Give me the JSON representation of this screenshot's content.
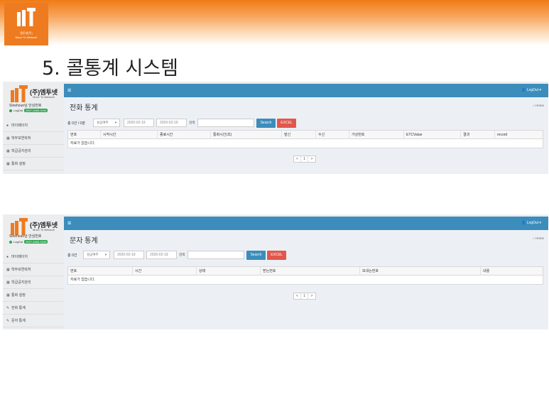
{
  "slide": {
    "title": "5. 콜통계 시스템",
    "logo_text": "엠투넷(주)",
    "logo_sub": "Move To Network"
  },
  "brand": {
    "name": "(주)엠투넷",
    "sub": "Move To Network"
  },
  "colors": {
    "accent_orange": "#ee7b20",
    "topbar_blue": "#3c8dbc",
    "search_blue": "#3c8dbc",
    "excel_red": "#e2574c",
    "online_green": "#2ea44f"
  },
  "screen1": {
    "user": "Sinehoun님 안심번호",
    "status": "LogOut",
    "phone": "0507-8465-0106",
    "logout_label": "LogOut",
    "menu": [
      {
        "label": "마이페이지",
        "icon": "dashboard-icon",
        "glyph": "●"
      },
      {
        "label": "학부모연락처",
        "icon": "grid-icon",
        "glyph": "▦"
      },
      {
        "label": "학급공지관리",
        "icon": "grid-icon",
        "glyph": "▦"
      },
      {
        "label": "통화 설정",
        "icon": "grid-icon",
        "glyph": "▦"
      }
    ],
    "page_title": "전화 통계",
    "home_label": "Home",
    "count": "총 0건 / 0분",
    "select_value": "성공여부",
    "date_from": "2020-02-19",
    "date_to": "2020-02-19",
    "search_label": "검색",
    "search_button": "Search",
    "excel_button": "EXCEL",
    "columns": [
      "번호",
      "시작시간",
      "종료시간",
      "통화시간(초)",
      "발신",
      "수신",
      "가상번호",
      "ETCValue",
      "결과",
      "record"
    ],
    "empty": "자료가 없습니다.",
    "pager": [
      "<",
      "1",
      ">"
    ]
  },
  "screen2": {
    "user": "Sinehoun님 안심번호",
    "status": "LogOut",
    "phone": "0507-8465-0106",
    "logout_label": "LogOut",
    "menu": [
      {
        "label": "마이페이지",
        "icon": "dashboard-icon",
        "glyph": "●"
      },
      {
        "label": "학부모연락처",
        "icon": "grid-icon",
        "glyph": "▦"
      },
      {
        "label": "학급공지관리",
        "icon": "grid-icon",
        "glyph": "▦"
      },
      {
        "label": "통화 설정",
        "icon": "grid-icon",
        "glyph": "▦"
      },
      {
        "label": "전화 통계",
        "icon": "edit-icon",
        "glyph": "✎"
      },
      {
        "label": "문자 통계",
        "icon": "edit-icon",
        "glyph": "✎"
      }
    ],
    "page_title": "문자 통계",
    "home_label": "Home",
    "count": "총 0건",
    "select_value": "성공여부",
    "date_from": "2020-02-19",
    "date_to": "2020-02-19",
    "search_label": "검색",
    "search_button": "Search",
    "excel_button": "EXCEL",
    "columns": [
      "번호",
      "시간",
      "상태",
      "받는번호",
      "보내는번호",
      "내용"
    ],
    "empty": "자료가 없습니다.",
    "pager": [
      "<",
      "1",
      ">"
    ]
  }
}
